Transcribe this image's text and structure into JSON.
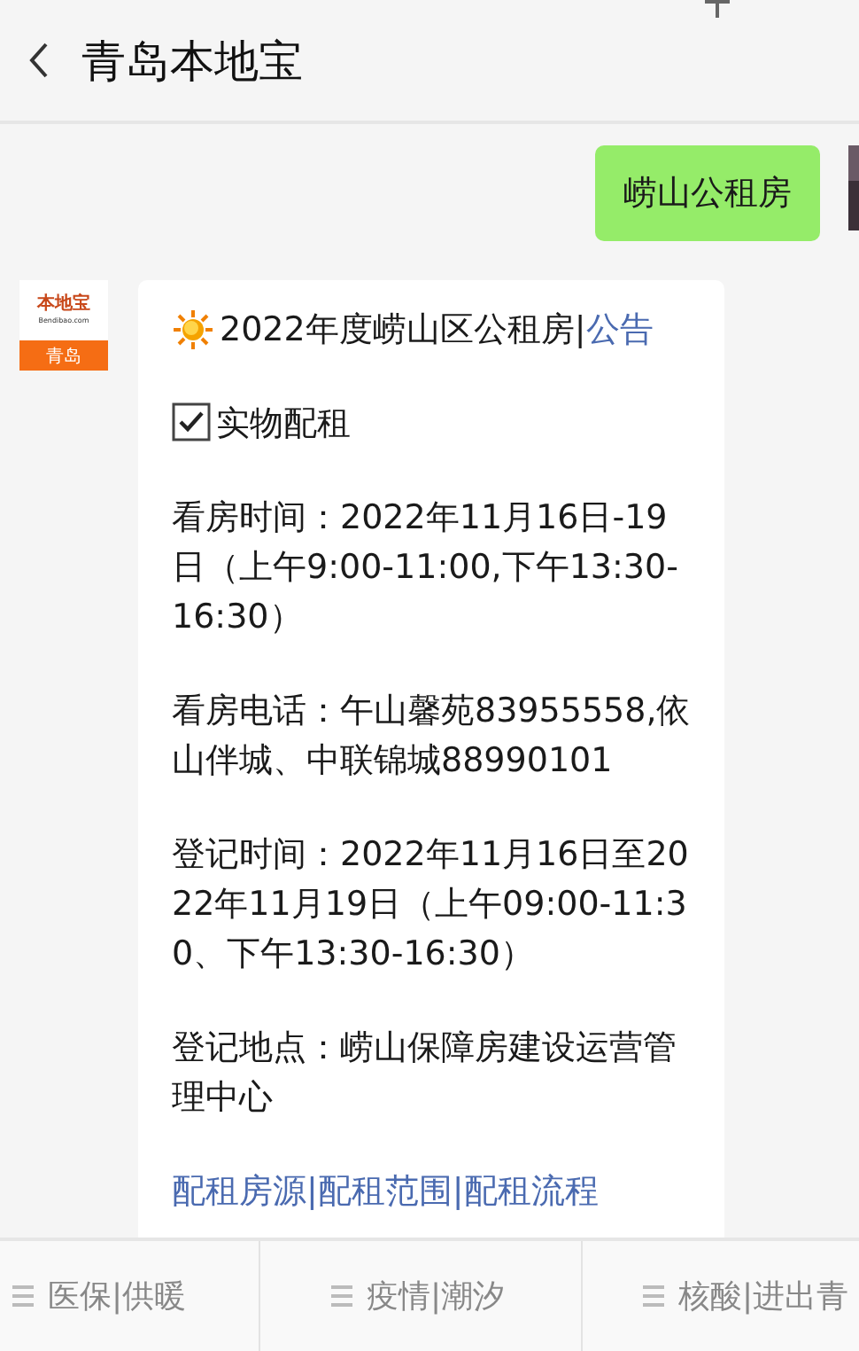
{
  "header": {
    "title": "青岛本地宝"
  },
  "messages": [
    {
      "kind": "sent",
      "text": "崂山公租房"
    },
    {
      "kind": "received",
      "avatar": {
        "top": "本地宝",
        "middle": "Bendibao.com",
        "bottom": "青岛"
      },
      "paragraphs": [
        {
          "kind": "title",
          "parts": [
            {
              "text": "2022年度崂山区公租房|",
              "link": false
            },
            {
              "text": "公告",
              "link": true
            }
          ]
        },
        {
          "kind": "check",
          "parts": [
            {
              "text": "实物配租",
              "link": false
            }
          ]
        },
        {
          "kind": "text",
          "parts": [
            {
              "text": "看房时间：2022年11月16日-19日（上午9:00-11:00,下午13:30-16:30）",
              "link": false
            }
          ]
        },
        {
          "kind": "text",
          "parts": [
            {
              "text": "看房电话：午山馨苑83955558,依山伴城、中联锦城88990101",
              "link": false
            }
          ]
        },
        {
          "kind": "text",
          "parts": [
            {
              "text": "登记时间：2022年11月16日至2022年11月19日（上午09:00-11:30、下午13:30-16:30）",
              "link": false
            }
          ]
        },
        {
          "kind": "text",
          "parts": [
            {
              "text": "登记地点：崂山保障房建设运营管理中心",
              "link": false
            }
          ]
        },
        {
          "kind": "text",
          "parts": [
            {
              "text": "配租房源|配租范围|配租流程",
              "link": true
            }
          ]
        }
      ]
    }
  ],
  "menu": [
    "医保|供暖",
    "疫情|潮汐",
    "核酸|进出青"
  ]
}
